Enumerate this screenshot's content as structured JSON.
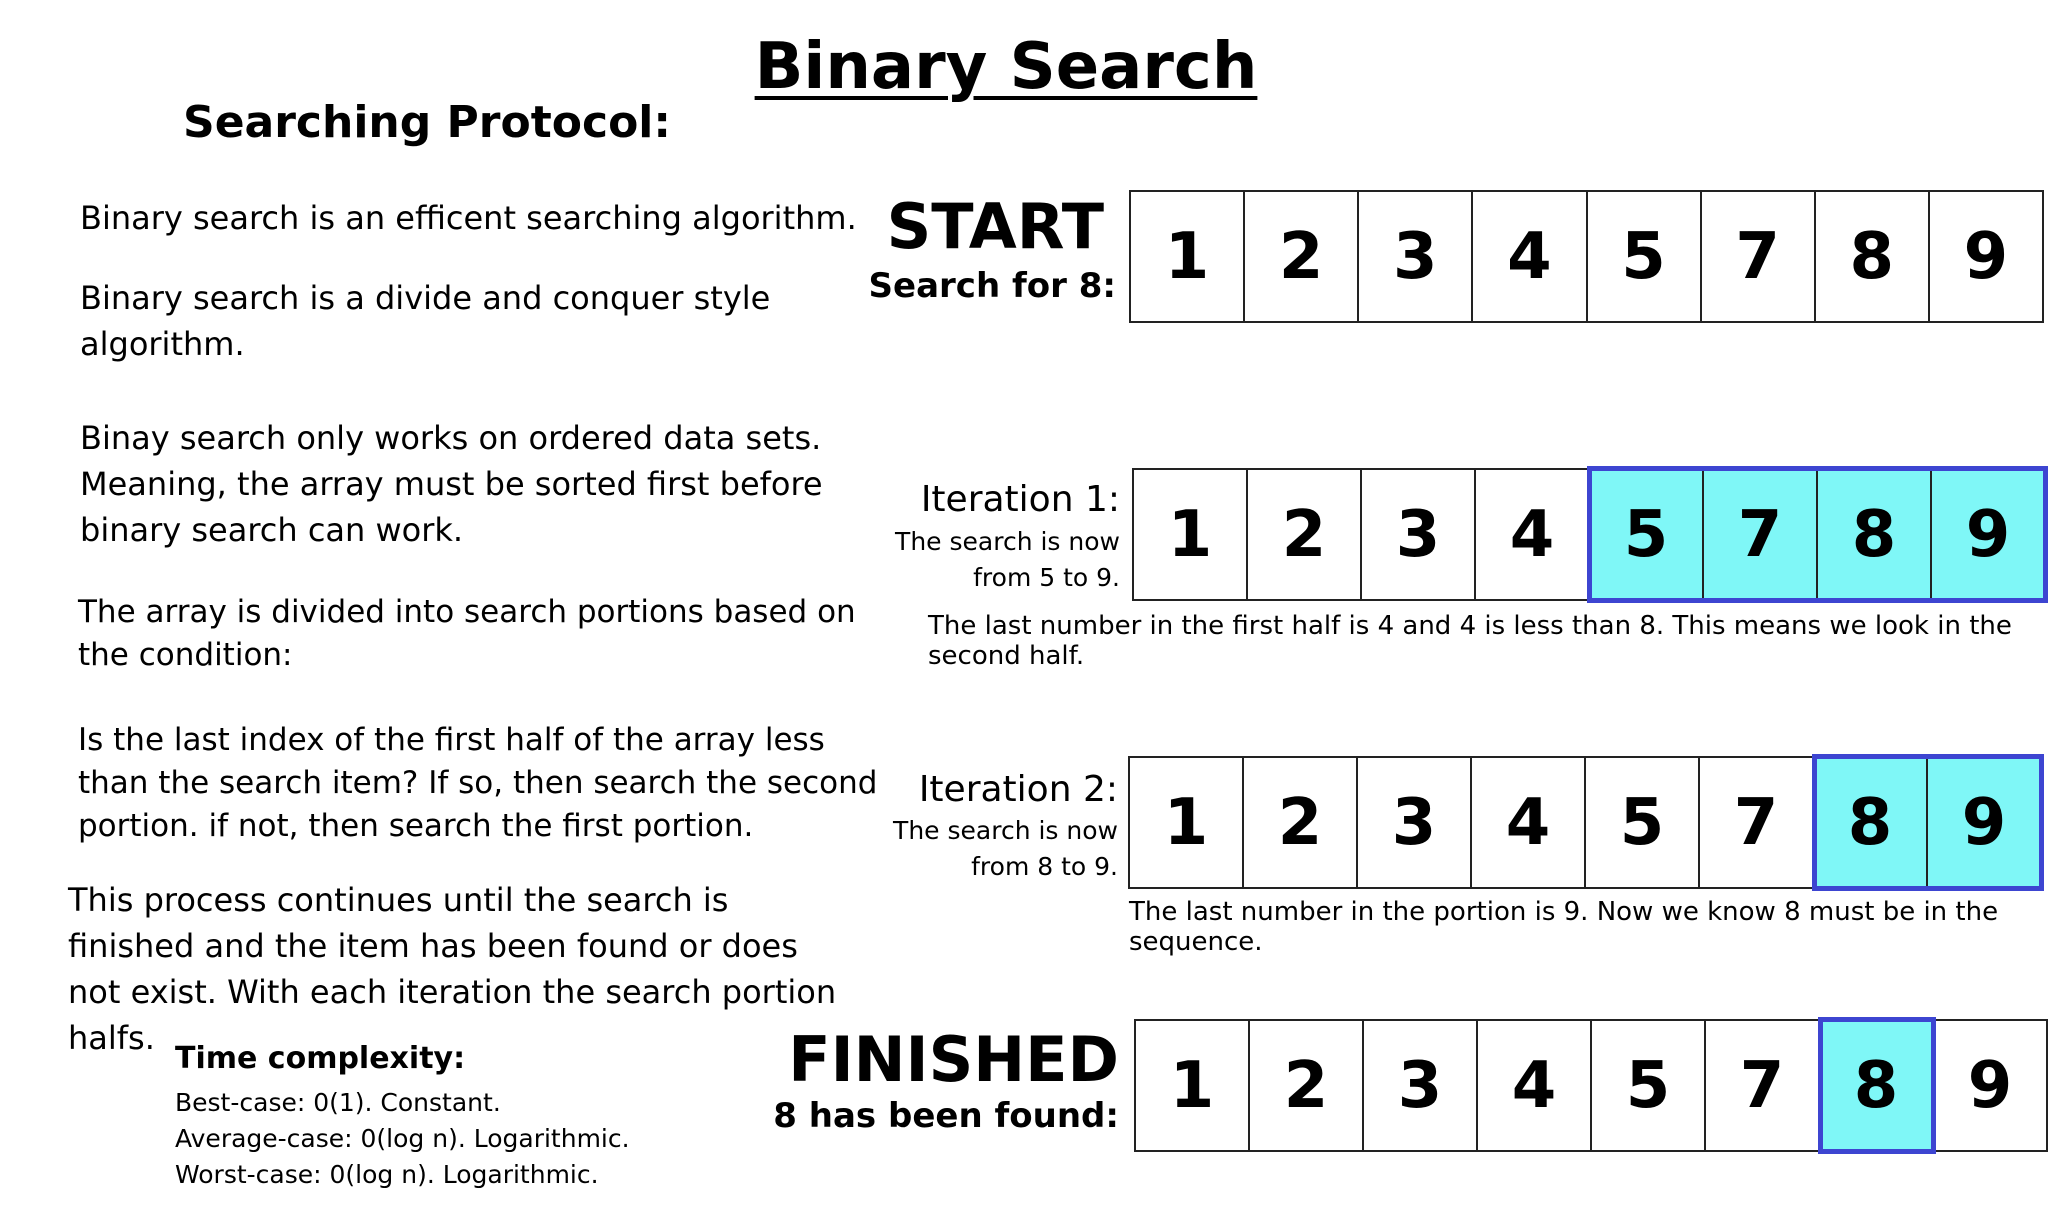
{
  "title": "Binary Search",
  "protocol": {
    "heading": "Searching Protocol:",
    "paragraphs": [
      "Binary search is an efficent searching algorithm.",
      "Binary search is a divide and conquer style algorithm.",
      "Binay search only works on ordered data sets. Meaning, the array must be sorted first before binary search can work.",
      "The array is divided into search portions based on the condition:",
      "Is the last index of the first half of the array less than the search item? If so, then search the second portion. if not, then search the first portion.",
      "This process continues until the search is finished and the item has been found or does not exist. With each iteration the search portion halfs."
    ]
  },
  "time_complexity": {
    "title": "Time complexity:",
    "lines": [
      "Best-case:  0(1). Constant.",
      "Average-case: 0(log n). Logarithmic.",
      "Worst-case: 0(log n). Logarithmic."
    ]
  },
  "array": [
    "1",
    "2",
    "3",
    "4",
    "5",
    "7",
    "8",
    "9"
  ],
  "highlight_color": "#7ff7f7",
  "highlight_border_color": "#3d45d1",
  "rows": {
    "start": {
      "label": "START",
      "sublabel": "Search for 8:",
      "highlighted": []
    },
    "iter1": {
      "label": "Iteration 1:",
      "sublabel_1": "The search is now",
      "sublabel_2": "from 5 to 9.",
      "highlighted": [
        4,
        5,
        6,
        7
      ],
      "note": "The last number in the first half is 4 and 4 is less than 8. This means we look in the second half."
    },
    "iter2": {
      "label": "Iteration 2:",
      "sublabel_1": "The search is now",
      "sublabel_2": "from 8 to 9.",
      "highlighted": [
        6,
        7
      ],
      "note": "The last number in the portion is 9. Now we know 8 must be in the sequence."
    },
    "finished": {
      "label": "FINISHED",
      "sublabel": "8 has been found:",
      "highlighted": [
        6
      ]
    }
  }
}
